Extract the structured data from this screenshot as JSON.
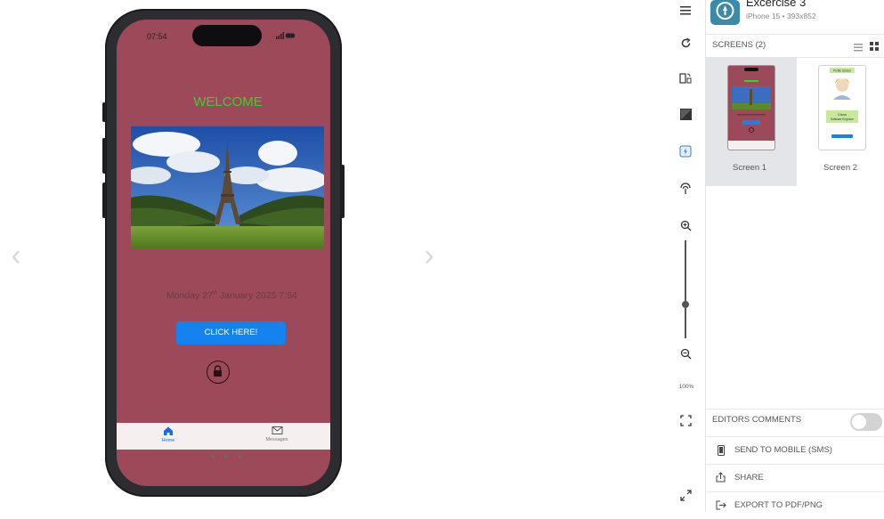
{
  "phone": {
    "status_time": "07:54",
    "status_icons": "..ıl ▬",
    "welcome": "WELCOME",
    "date_prefix": "Monday 27",
    "date_sup": "th",
    "date_suffix": " January 2025 7:54",
    "button_label": "CLICK HERE!",
    "tabs": [
      {
        "label": "Home",
        "icon": "home-icon",
        "active": true
      },
      {
        "label": "Messages",
        "icon": "envelope-icon",
        "active": false
      }
    ],
    "colors": {
      "screen_bg": "#9c4a5a",
      "welcome": "#3bd02f",
      "button": "#1682f0"
    }
  },
  "carousel": {
    "prev_glyph": "‹",
    "next_glyph": "›"
  },
  "toolbar": {
    "icons": [
      "menu-icon",
      "refresh-icon",
      "rotate-device-icon",
      "contrast-icon",
      "flash-icon",
      "broadcast-icon",
      "zoom-in-icon",
      "zoom-out-icon",
      "fullscreen-icon",
      "expand-icon"
    ],
    "zoom_label": "100%"
  },
  "project": {
    "name": "Excercise 3",
    "device": "iPhone 15 • 393x852"
  },
  "screens": {
    "title": "SCREENS (2)",
    "items": [
      {
        "label": "Screen 1",
        "selected": true
      },
      {
        "label": "Screen 2",
        "selected": false
      }
    ],
    "thumb2": {
      "header": "Profile Screen",
      "name": "Diana",
      "role": "Software Engineer"
    }
  },
  "panel": {
    "editors_comments": "EDITORS COMMENTS",
    "send_to_mobile": "SEND TO MOBILE (SMS)",
    "share": "SHARE",
    "export": "EXPORT TO PDF/PNG"
  }
}
